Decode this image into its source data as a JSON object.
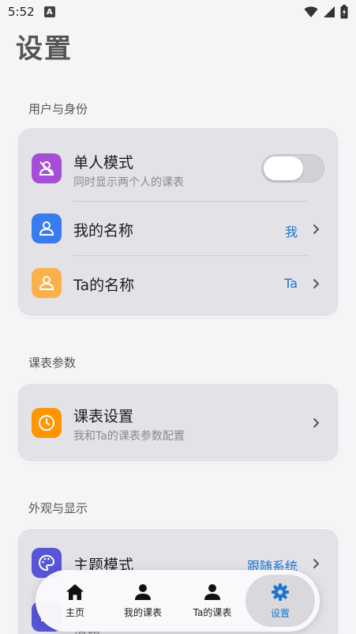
{
  "status": {
    "time": "5:52",
    "notification_badge": "A"
  },
  "page_title": "设置",
  "sections": {
    "identity": {
      "label": "用户与身份",
      "single_mode": {
        "title": "单人模式",
        "subtitle": "同时显示两个人的课表",
        "enabled": false
      },
      "my_name": {
        "title": "我的名称",
        "value": "我"
      },
      "ta_name": {
        "title": "Ta的名称",
        "value": "Ta"
      }
    },
    "schedule": {
      "label": "课表参数",
      "settings": {
        "title": "课表设置",
        "subtitle": "我和Ta的课表参数配置"
      }
    },
    "appearance": {
      "label": "外观与显示",
      "theme": {
        "title": "主题模式",
        "value": "跟随系统"
      },
      "partial_title": "提醒"
    }
  },
  "bottom_nav": {
    "home": "主页",
    "my_schedule": "我的课表",
    "ta_schedule": "Ta的课表",
    "settings": "设置"
  },
  "colors": {
    "accent": "#1976d2",
    "purple": "#a64fd6",
    "blue": "#3a7bf0",
    "orange": "#fbb14a",
    "clock_orange": "#ff9500",
    "indigo": "#5856d6"
  }
}
